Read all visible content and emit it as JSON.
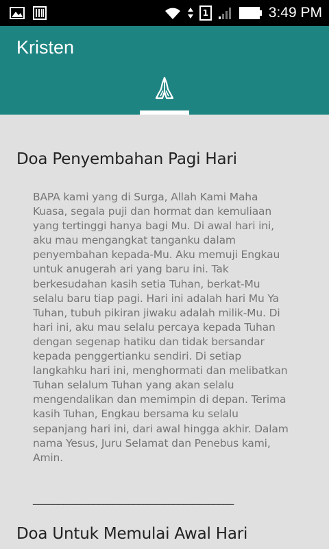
{
  "status_bar": {
    "time": "3:49 PM",
    "icons": [
      "image-icon",
      "barcode-icon",
      "wifi-icon",
      "data-arrows-icon",
      "sim-1-icon",
      "signal-icon",
      "battery-icon"
    ],
    "sim_label": "1"
  },
  "app_bar": {
    "title": "Kristen",
    "color": "#1e8481",
    "tab_icon": "praying-hands-icon"
  },
  "sections": [
    {
      "title": "Doa Penyembahan Pagi Hari",
      "body": "BAPA kami yang di Surga, Allah Kami Maha\nKuasa, segala puji dan hormat dan kemuliaan\nyang tertinggi hanya bagi Mu. Di awal hari ini,\naku mau mengangkat tanganku dalam\npenyembahan kepada-Mu. Aku memuji Engkau\nuntuk anugerah ari yang baru ini. Tak\nberkesudahan kasih setia Tuhan, berkat-Mu\nselalu baru tiap pagi. Hari ini adalah hari Mu Ya\nTuhan, tubuh pikiran jiwaku adalah milik-Mu. Di\nhari ini, aku mau selalu percaya kepada Tuhan\ndengan segenap hatiku dan tidak bersandar\nkepada penggertianku sendiri. Di setiap\nlangkahku hari ini, menghormati dan melibatkan\nTuhan selalum Tuhan yang akan selalu\nmengendalikan dan memimpin di depan. Terima\nkasih Tuhan, Engkau bersama ku selalu\nsepanjang hari ini, dari awal hingga akhir. Dalam\nnama Yesus, Juru Selamat dan Penebus kami,\nAmin.",
      "separator": "________________________________________"
    },
    {
      "title": "Doa Untuk Memulai Awal Hari"
    }
  ]
}
